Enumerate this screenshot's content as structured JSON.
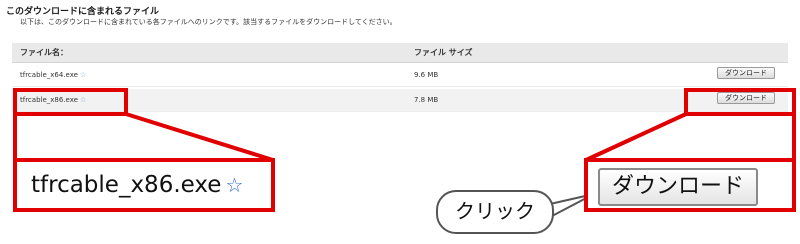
{
  "header": {
    "title": "このダウンロードに含まれるファイル",
    "description": "以下は、このダウンロードに含まれている各ファイルへのリンクです。該当するファイルをダウンロードしてください。"
  },
  "table": {
    "columns": [
      "ファイル名：",
      "ファイル サイズ"
    ],
    "rows": [
      {
        "name": "tfrcable_x64.exe",
        "size": "9.6 MB",
        "button": "ダウンロード"
      },
      {
        "name": "tfrcable_x86.exe",
        "size": "7.8 MB",
        "button": "ダウンロード"
      }
    ]
  },
  "callout": {
    "zoom_filename": "tfrcable_x86.exe",
    "zoom_button": "ダウンロード",
    "bubble": "クリック"
  },
  "colors": {
    "highlight": "#e00000",
    "header_bg": "#e9e9e9"
  },
  "icons": {
    "star": "star-icon"
  }
}
